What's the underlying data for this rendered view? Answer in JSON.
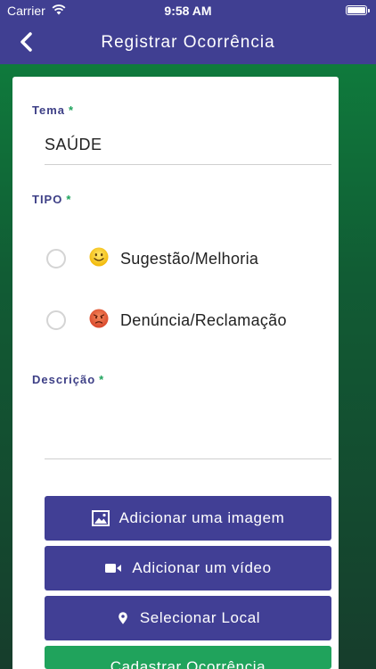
{
  "status_bar": {
    "carrier": "Carrier",
    "time": "9:58 AM"
  },
  "nav": {
    "title": "Registrar Ocorrência",
    "back_icon": "chevron-left-icon"
  },
  "form": {
    "tema": {
      "label": "Tema",
      "required_mark": "*",
      "value": "SAÚDE"
    },
    "tipo": {
      "label": "TIPO",
      "required_mark": "*",
      "options": [
        {
          "label": "Sugestão/Melhoria",
          "icon": "smiley-icon",
          "selected": false
        },
        {
          "label": "Denúncia/Reclamação",
          "icon": "angry-face-icon",
          "selected": false
        }
      ]
    },
    "descricao": {
      "label": "Descrição",
      "required_mark": "*",
      "value": ""
    }
  },
  "buttons": {
    "add_image": {
      "label": "Adicionar uma imagem",
      "icon": "image-icon"
    },
    "add_video": {
      "label": "Adicionar um vídeo",
      "icon": "video-camera-icon"
    },
    "select_location": {
      "label": "Selecionar Local",
      "icon": "map-pin-icon"
    },
    "submit": {
      "label": "Cadastrar Ocorrência"
    }
  },
  "colors": {
    "primary": "#403f92",
    "accent_green": "#20a35c",
    "label": "#3d3f86"
  }
}
